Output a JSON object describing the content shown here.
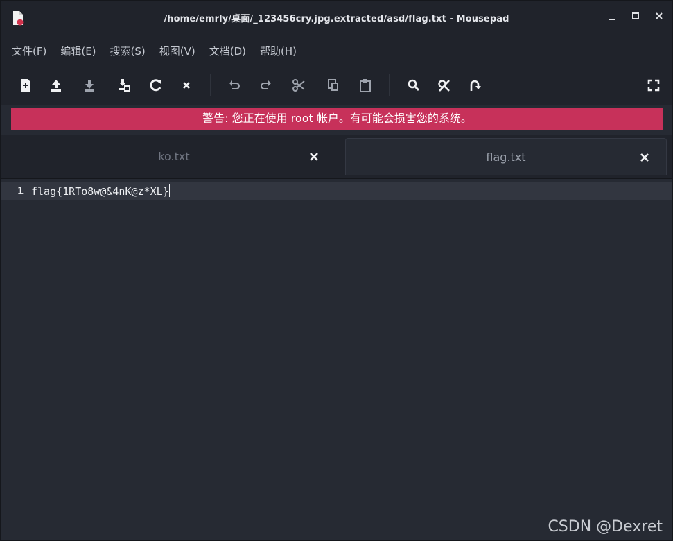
{
  "window": {
    "title": "/home/emrly/桌面/_123456cry.jpg.extracted/asd/flag.txt - Mousepad",
    "icon": "mousepad-document-icon"
  },
  "menu": {
    "items": [
      {
        "label": "文件(F)"
      },
      {
        "label": "编辑(E)"
      },
      {
        "label": "搜索(S)"
      },
      {
        "label": "视图(V)"
      },
      {
        "label": "文档(D)"
      },
      {
        "label": "帮助(H)"
      }
    ]
  },
  "toolbar": {
    "icons": [
      "new-document-icon",
      "open-upload-icon",
      "save-download-icon",
      "save-as-icon",
      "reload-icon",
      "close-icon",
      "undo-icon",
      "redo-icon",
      "cut-icon",
      "copy-icon",
      "paste-icon",
      "search-icon",
      "find-replace-icon",
      "go-to-line-icon",
      "fullscreen-icon"
    ]
  },
  "warning": {
    "text": "警告: 您正在使用 root 帐户。有可能会损害您的系统。",
    "color": "#c7315a"
  },
  "tabs": [
    {
      "label": "ko.txt",
      "active": false
    },
    {
      "label": "flag.txt",
      "active": true
    }
  ],
  "editor": {
    "lines": [
      {
        "number": "1",
        "text": "flag{1RTo8w@&4nK@z*XL}"
      }
    ]
  },
  "watermark": "CSDN @Dexret"
}
